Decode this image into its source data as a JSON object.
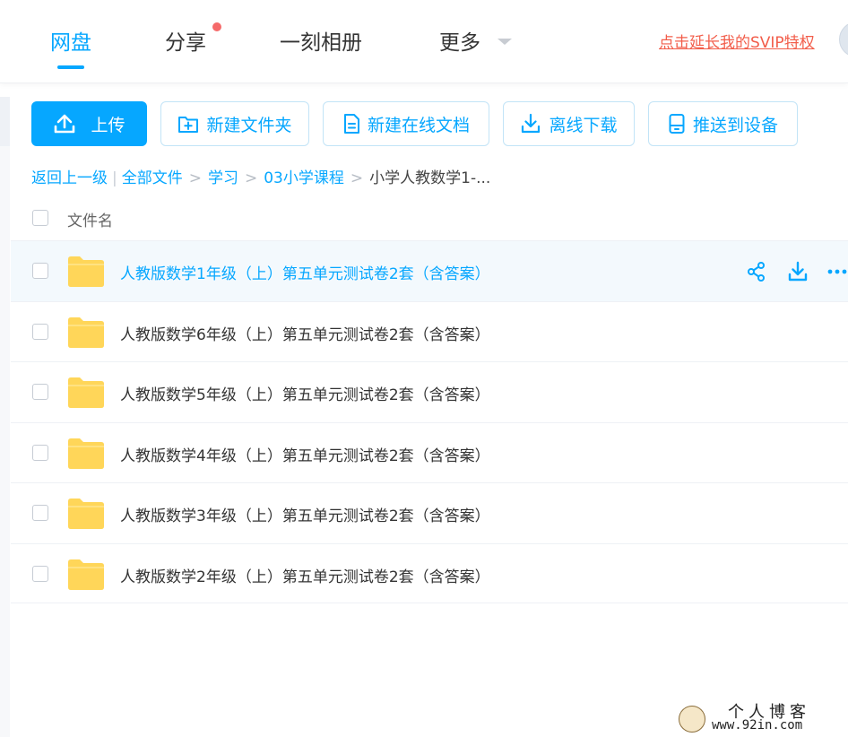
{
  "nav": {
    "tabs": [
      {
        "label": "网盘",
        "active": true
      },
      {
        "label": "分享",
        "active": false,
        "notification_dot": true
      },
      {
        "label": "一刻相册",
        "active": false
      },
      {
        "label": "更多",
        "active": false,
        "has_dropdown": true
      }
    ],
    "svip_link": "点击延长我的SVIP特权"
  },
  "toolbar": {
    "upload": {
      "label": "上传",
      "icon": "upload-icon"
    },
    "new_folder": {
      "label": "新建文件夹",
      "icon": "folder-plus-icon"
    },
    "new_doc": {
      "label": "新建在线文档",
      "icon": "document-icon"
    },
    "offline_download": {
      "label": "离线下载",
      "icon": "download-icon"
    },
    "push_device": {
      "label": "推送到设备",
      "icon": "device-icon"
    }
  },
  "breadcrumb": {
    "back": "返回上一级",
    "items": [
      "全部文件",
      "学习",
      "03小学课程"
    ],
    "current": "小学人教数学1-..."
  },
  "list": {
    "header": "文件名",
    "rows": [
      {
        "name": "人教版数学1年级（上）第五单元测试卷2套（含答案）",
        "hover": true
      },
      {
        "name": "人教版数学6年级（上）第五单元测试卷2套（含答案）",
        "hover": false
      },
      {
        "name": "人教版数学5年级（上）第五单元测试卷2套（含答案）",
        "hover": false
      },
      {
        "name": "人教版数学4年级（上）第五单元测试卷2套（含答案）",
        "hover": false
      },
      {
        "name": "人教版数学3年级（上）第五单元测试卷2套（含答案）",
        "hover": false
      },
      {
        "name": "人教版数学2年级（上）第五单元测试卷2套（含答案）",
        "hover": false
      }
    ],
    "row_actions": [
      "share-icon",
      "download-icon",
      "more-icon"
    ]
  },
  "watermark": {
    "title": "个人博客",
    "url": "www.92in.com"
  },
  "colors": {
    "accent": "#06a7ff",
    "folder": "#ffd659",
    "notify_dot": "#f56a6a",
    "svip_link": "#f25d4a",
    "row_hover": "#f3f9fd"
  }
}
